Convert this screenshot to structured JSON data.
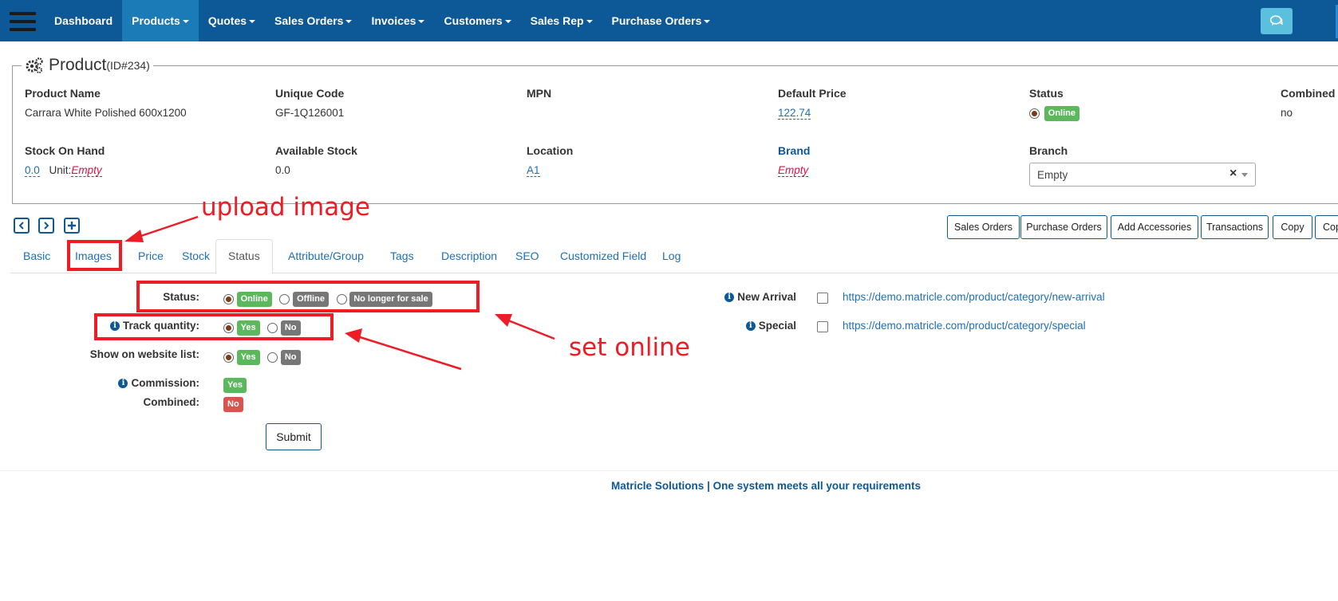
{
  "nav": {
    "items": [
      {
        "label": "Dashboard",
        "caret": false,
        "active": false
      },
      {
        "label": "Products",
        "caret": true,
        "active": true
      },
      {
        "label": "Quotes",
        "caret": true,
        "active": false
      },
      {
        "label": "Sales Orders",
        "caret": true,
        "active": false
      },
      {
        "label": "Invoices",
        "caret": true,
        "active": false
      },
      {
        "label": "Customers",
        "caret": true,
        "active": false
      },
      {
        "label": "Sales Rep",
        "caret": true,
        "active": false
      },
      {
        "label": "Purchase Orders",
        "caret": true,
        "active": false
      }
    ],
    "accent": "#0d5896",
    "active_bg": "#1b7bb7"
  },
  "product": {
    "title": "Product",
    "id_label": "(ID#234)",
    "fields": {
      "product_name": {
        "label": "Product Name",
        "value": "Carrara White Polished 600x1200"
      },
      "unique_code": {
        "label": "Unique Code",
        "value": "GF-1Q126001"
      },
      "mpn": {
        "label": "MPN",
        "value": ""
      },
      "default_price": {
        "label": "Default Price",
        "value": "122.74"
      },
      "status": {
        "label": "Status",
        "value": "Online"
      },
      "combined": {
        "label": "Combined",
        "value": "no"
      },
      "stock_on_hand": {
        "label": "Stock On Hand",
        "value": "0.0",
        "unit_label": "Unit:",
        "unit_value": "Empty"
      },
      "available_stock": {
        "label": "Available Stock",
        "value": "0.0"
      },
      "location": {
        "label": "Location",
        "value": "A1"
      },
      "brand": {
        "label": "Brand",
        "value": "Empty"
      },
      "branch": {
        "label": "Branch",
        "value": "Empty",
        "clear": "×"
      }
    }
  },
  "actions": [
    "Sales Orders",
    "Purchase Orders",
    "Add Accessories",
    "Transactions",
    "Copy",
    "Copy"
  ],
  "tabs": [
    "Basic",
    "Images",
    "Price",
    "Stock",
    "Status",
    "Attribute/Group",
    "Tags",
    "Description",
    "SEO",
    "Customized Field",
    "Log"
  ],
  "active_tab": "Status",
  "form": {
    "status": {
      "label": "Status:",
      "options": [
        "Online",
        "Offline",
        "No longer for sale"
      ],
      "selected": "Online"
    },
    "track_quantity": {
      "label": "Track quantity:",
      "options": [
        "Yes",
        "No"
      ],
      "selected": "Yes"
    },
    "show_on_website": {
      "label": "Show on website list:",
      "options": [
        "Yes",
        "No"
      ],
      "selected": "Yes"
    },
    "commission": {
      "label": "Commission:",
      "value": "Yes"
    },
    "combined": {
      "label": "Combined:",
      "value": "No"
    },
    "new_arrival": {
      "label": "New Arrival",
      "url": "https://demo.matricle.com/product/category/new-arrival"
    },
    "special": {
      "label": "Special",
      "url": "https://demo.matricle.com/product/category/special"
    },
    "submit": "Submit"
  },
  "footer": "Matricle Solutions | One system meets all your requirements",
  "annotations": {
    "upload_image": "upload image",
    "set_online": "set online",
    "color": "#ee1c24"
  }
}
